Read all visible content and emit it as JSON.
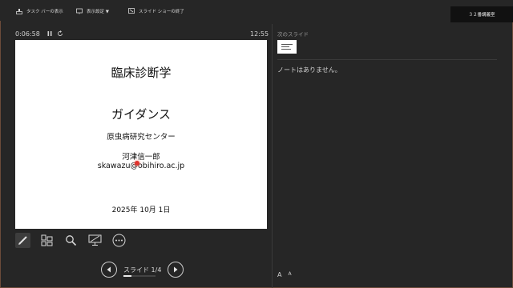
{
  "toolbar": {
    "taskbar_label": "タスク バーの表示",
    "display_settings_label": "表示設定 ▼",
    "end_show_label": "スライド ショーの終了",
    "right_label": "３２番講義室"
  },
  "presenter": {
    "elapsed": "0:06:58",
    "pause_icon": "pause-icon",
    "reset_icon": "restart-icon",
    "clock": "12:55"
  },
  "slide": {
    "title": "臨床診断学",
    "subtitle": "ガイダンス",
    "center": "原虫病研究センター",
    "name": "河津信一郎",
    "email": "skawazu@obihiro.ac.jp",
    "date": "2025年  10月    1日"
  },
  "tools": [
    "pen-icon",
    "slides-grid-icon",
    "zoom-icon",
    "screen-icon",
    "more-icon"
  ],
  "nav": {
    "counter": "スライド 1/4",
    "progress": 0.25
  },
  "sidebar": {
    "next_slide_label": "次のスライド",
    "notes_text": "ノートはありません。",
    "font_increase": "A",
    "font_decrease": "A"
  },
  "colors": {
    "background": "#262626",
    "laser": "#e0342e"
  }
}
